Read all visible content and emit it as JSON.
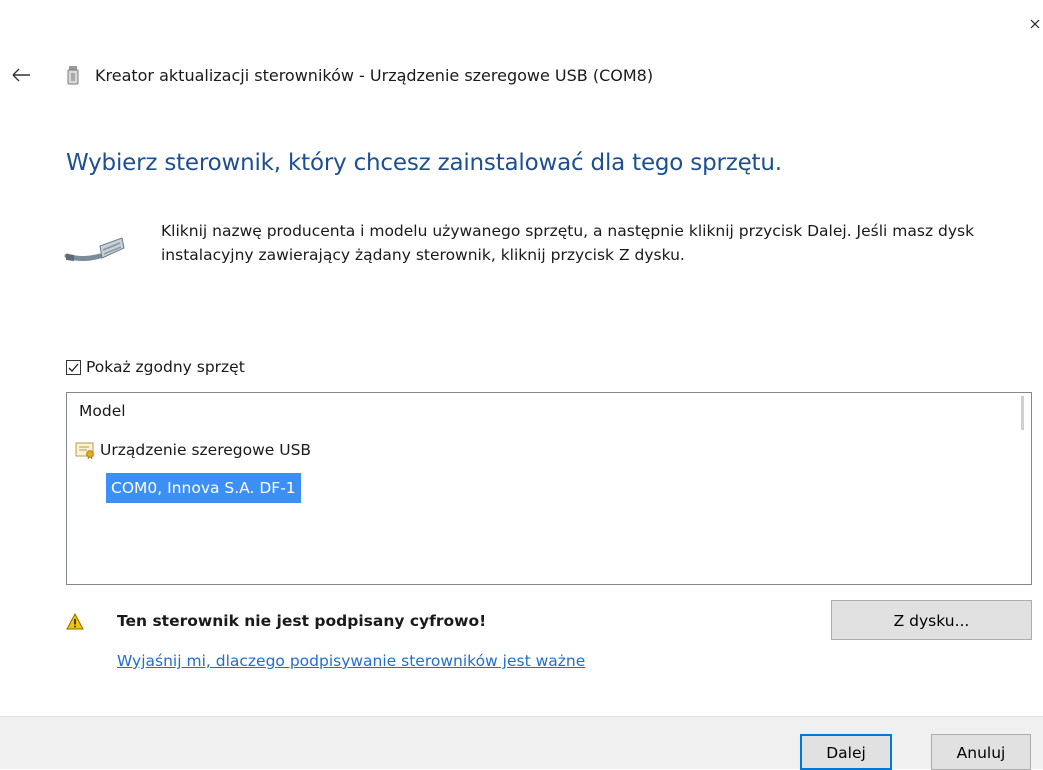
{
  "window": {
    "title": "Kreator aktualizacji sterowników - Urządzenie szeregowe USB (COM8)",
    "close_icon": "close-icon",
    "back_icon": "back-arrow-icon"
  },
  "heading": "Wybierz sterownik, który chcesz zainstalować dla tego sprzętu.",
  "instructions": "Kliknij nazwę producenta i modelu używanego sprzętu, a następnie kliknij przycisk Dalej. Jeśli masz dysk instalacyjny zawierający żądany sterownik, kliknij przycisk Z dysku.",
  "show_compatible": {
    "label": "Pokaż zgodny sprzęt",
    "checked": true
  },
  "model_list": {
    "header": "Model",
    "manufacturer": "Urządzenie szeregowe USB",
    "items": [
      {
        "label": "COM0, Innova S.A. DF-1",
        "selected": true
      }
    ]
  },
  "warning": {
    "text": "Ten sterownik nie jest podpisany cyfrowo!",
    "link": "Wyjaśnij mi, dlaczego podpisywanie sterowników jest ważne"
  },
  "buttons": {
    "have_disk": "Z dysku...",
    "next": "Dalej",
    "cancel": "Anuluj"
  },
  "colors": {
    "heading": "#1d4f91",
    "selection": "#3c8ff5",
    "link": "#1f6fcf",
    "warning": "#f5c400",
    "default_button_border": "#0078d7"
  }
}
